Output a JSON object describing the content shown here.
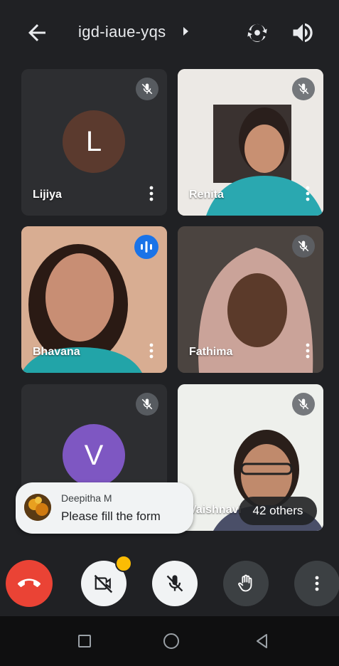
{
  "header": {
    "meeting_code": "igd-iaue-yqs"
  },
  "participants": [
    {
      "name": "Lijiya",
      "initial": "L",
      "avatar_color": "#5b3a2e",
      "muted": true
    },
    {
      "name": "Renita",
      "muted": true
    },
    {
      "name": "Bhavana",
      "muted": false,
      "speaking": true
    },
    {
      "name": "Fathima",
      "muted": true
    },
    {
      "name": "",
      "initial": "V",
      "avatar_color": "#7e57c2",
      "muted": true
    },
    {
      "name": "Vaishnavi",
      "muted": true
    }
  ],
  "others_label": "42 others",
  "toast": {
    "sender": "Deepitha M",
    "message": "Please fill the form"
  },
  "colors": {
    "end_call": "#ea4335",
    "speaking_badge": "#1a73e8",
    "notification_dot": "#fbbc04"
  },
  "icons": {
    "back": "arrow-left-icon",
    "switch_camera": "switch-camera-icon",
    "speaker": "speaker-icon",
    "end_call": "phone-hangup-icon",
    "camera_off": "camera-off-icon",
    "mic_off": "mic-off-icon",
    "raise_hand": "hand-icon",
    "more": "more-vert-icon"
  }
}
